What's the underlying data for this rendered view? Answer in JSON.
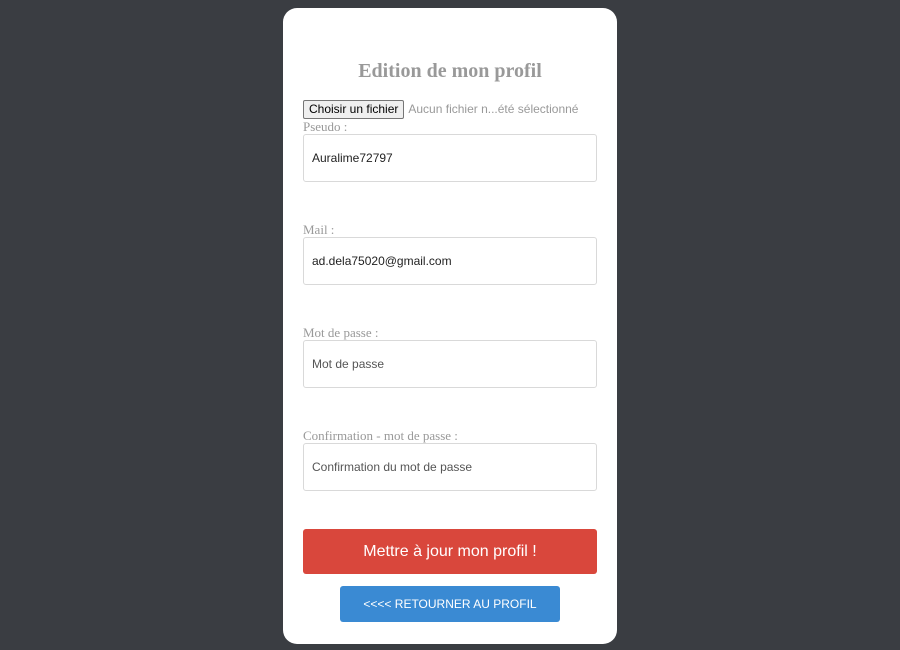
{
  "form": {
    "title": "Edition de mon profil",
    "file": {
      "button_label": "Choisir un fichier",
      "status": "Aucun fichier n...été sélectionné"
    },
    "fields": {
      "pseudo": {
        "label": "Pseudo :",
        "value": "Auralime72797",
        "placeholder": ""
      },
      "mail": {
        "label": "Mail :",
        "value": "ad.dela75020@gmail.com",
        "placeholder": ""
      },
      "password": {
        "label": "Mot de passe :",
        "value": "",
        "placeholder": "Mot de passe"
      },
      "password_confirm": {
        "label": "Confirmation - mot de passe :",
        "value": "",
        "placeholder": "Confirmation du mot de passe"
      }
    },
    "update_button_label": "Mettre à jour mon profil !",
    "back_button_label": "<<<< RETOURNER AU PROFIL"
  },
  "colors": {
    "page_background": "#3a3d42",
    "card_background": "#ffffff",
    "update_button": "#d9473c",
    "back_button": "#3a8ad3",
    "label_text": "#999999"
  }
}
